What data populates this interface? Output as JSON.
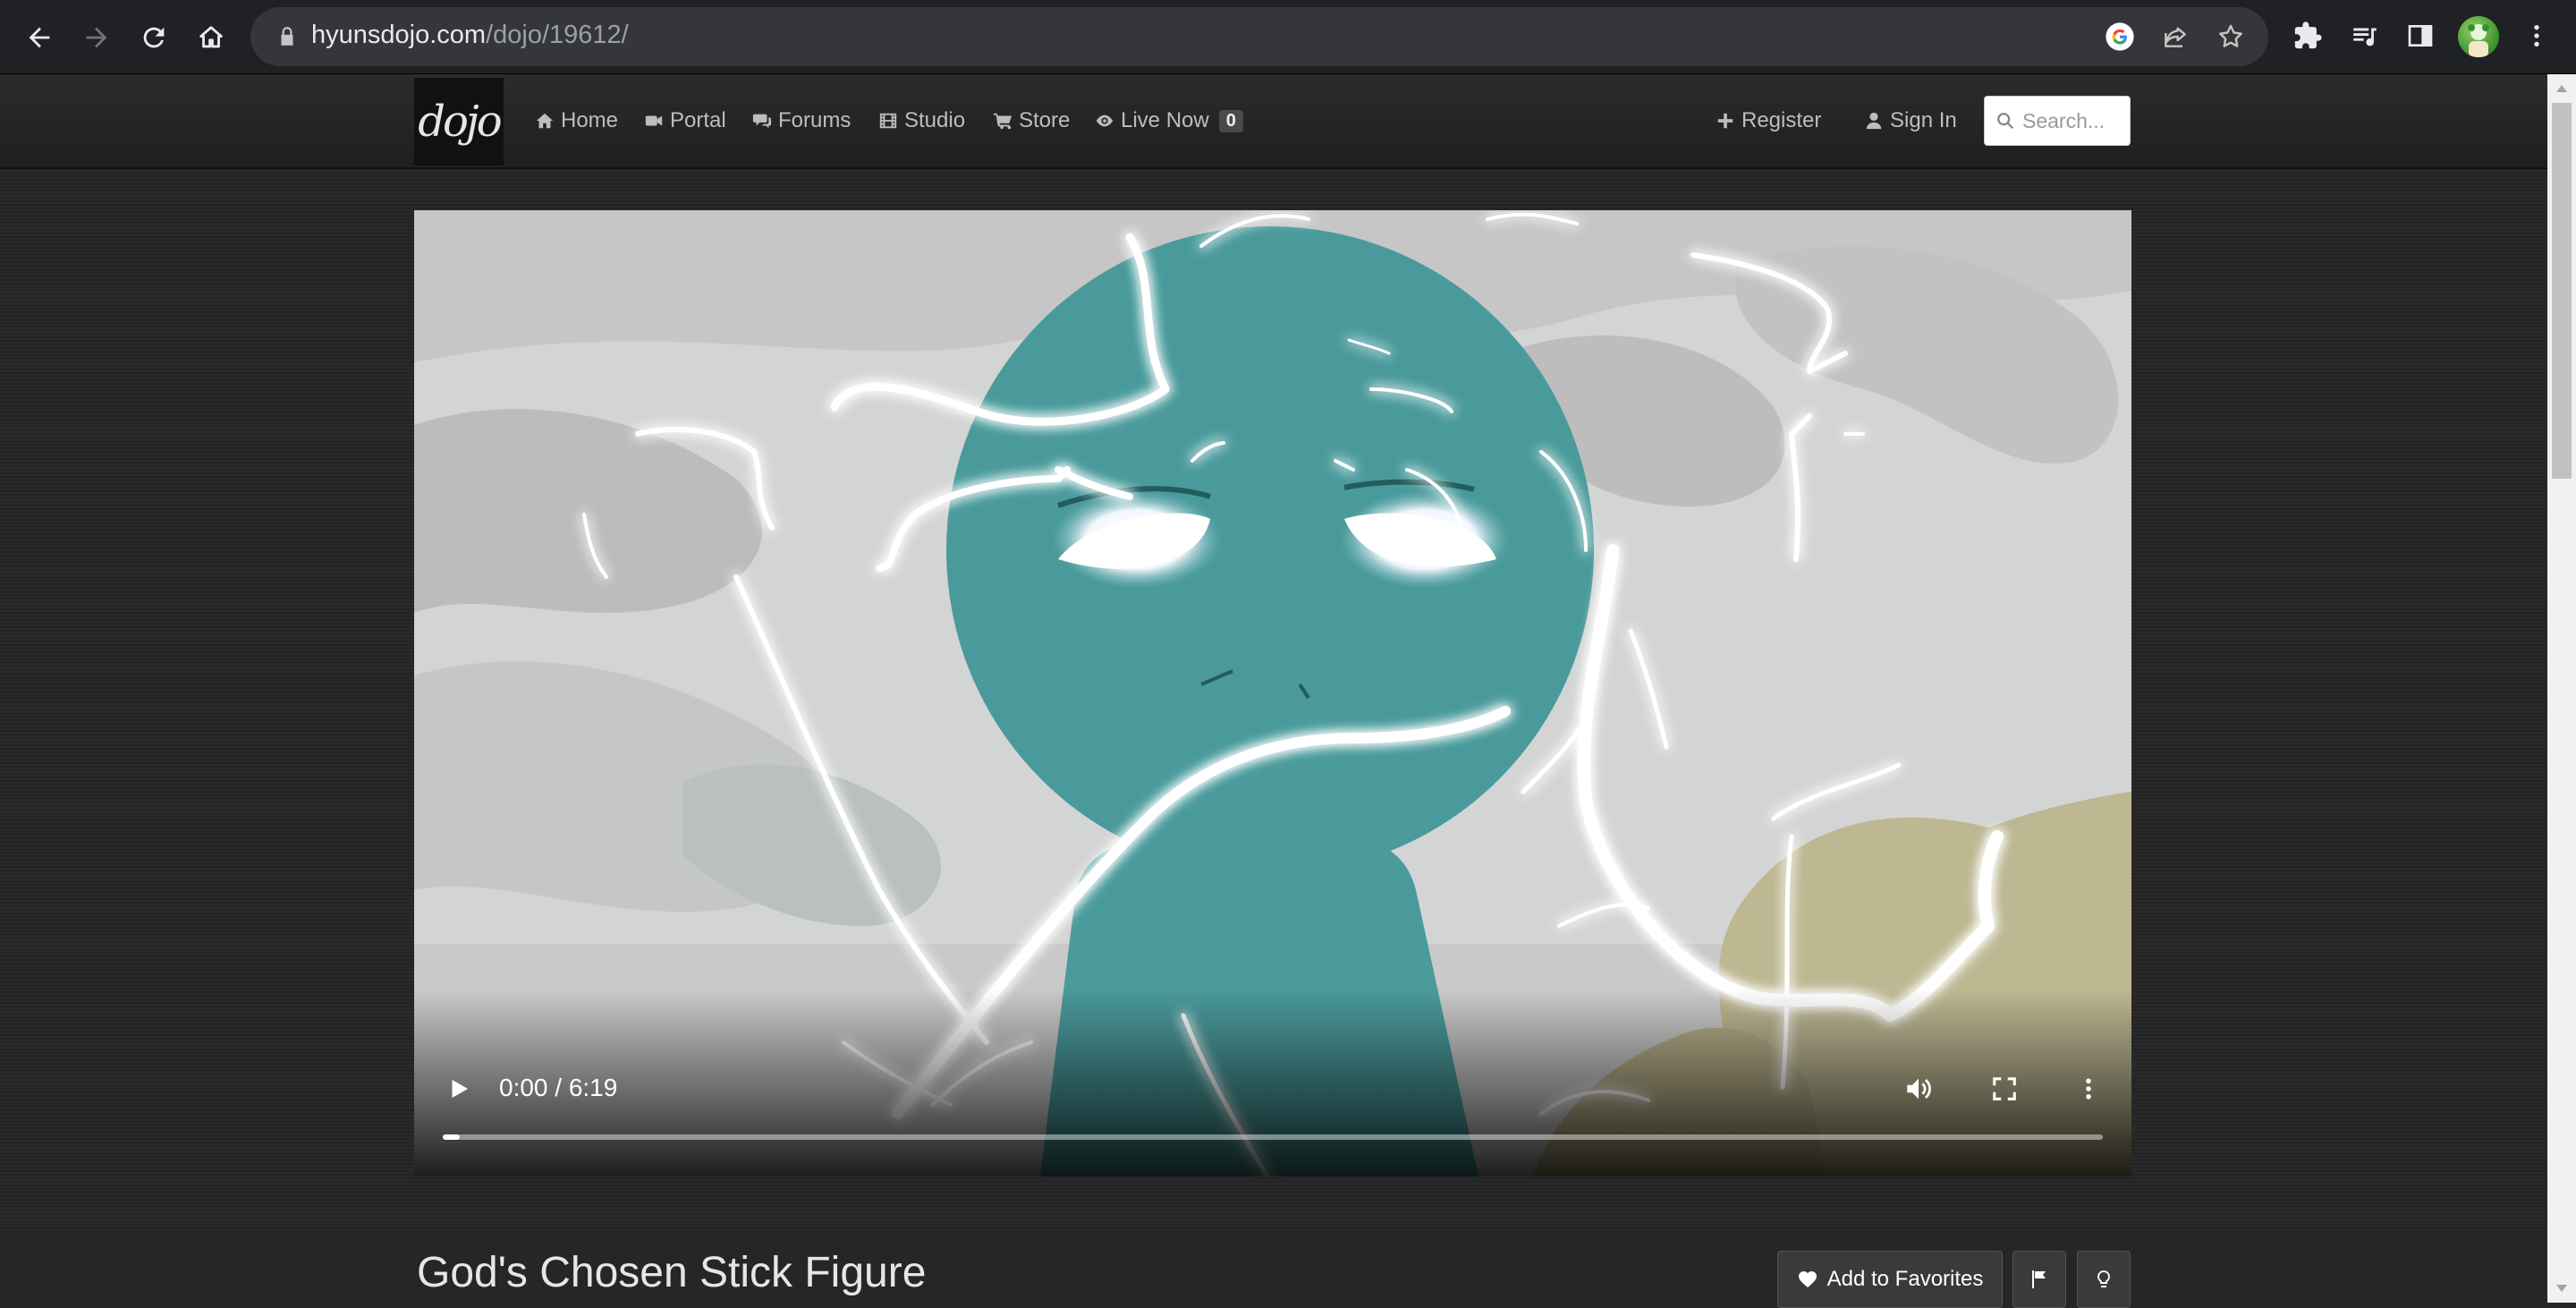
{
  "browser": {
    "url_domain": "hyunsdojo.com",
    "url_path": "/dojo/19612/",
    "icons": [
      "back-icon",
      "forward-icon",
      "reload-icon",
      "home-icon",
      "lock-icon",
      "google-icon",
      "share-icon",
      "star-icon",
      "extensions-icon",
      "media-icon",
      "sidepanel-icon",
      "avatar",
      "menu-icon"
    ]
  },
  "site": {
    "logo_text": "dojo",
    "nav": [
      {
        "label": "Home",
        "icon": "home-icon"
      },
      {
        "label": "Portal",
        "icon": "video-camera-icon"
      },
      {
        "label": "Forums",
        "icon": "comments-icon"
      },
      {
        "label": "Studio",
        "icon": "film-icon"
      },
      {
        "label": "Store",
        "icon": "cart-icon"
      },
      {
        "label": "Live Now",
        "icon": "eye-icon",
        "badge": "0"
      }
    ],
    "register_label": "Register",
    "signin_label": "Sign In",
    "search_placeholder": "Search..."
  },
  "video": {
    "time": "0:00 / 6:19",
    "progress": 0.01
  },
  "page": {
    "title": "God's Chosen Stick Figure",
    "favorite_label": "Add to Favorites"
  },
  "colors": {
    "figure": "#4a9a9c",
    "lightning": "#ffffff",
    "glow": "#a9c8ff",
    "ground": "#bdb792"
  }
}
